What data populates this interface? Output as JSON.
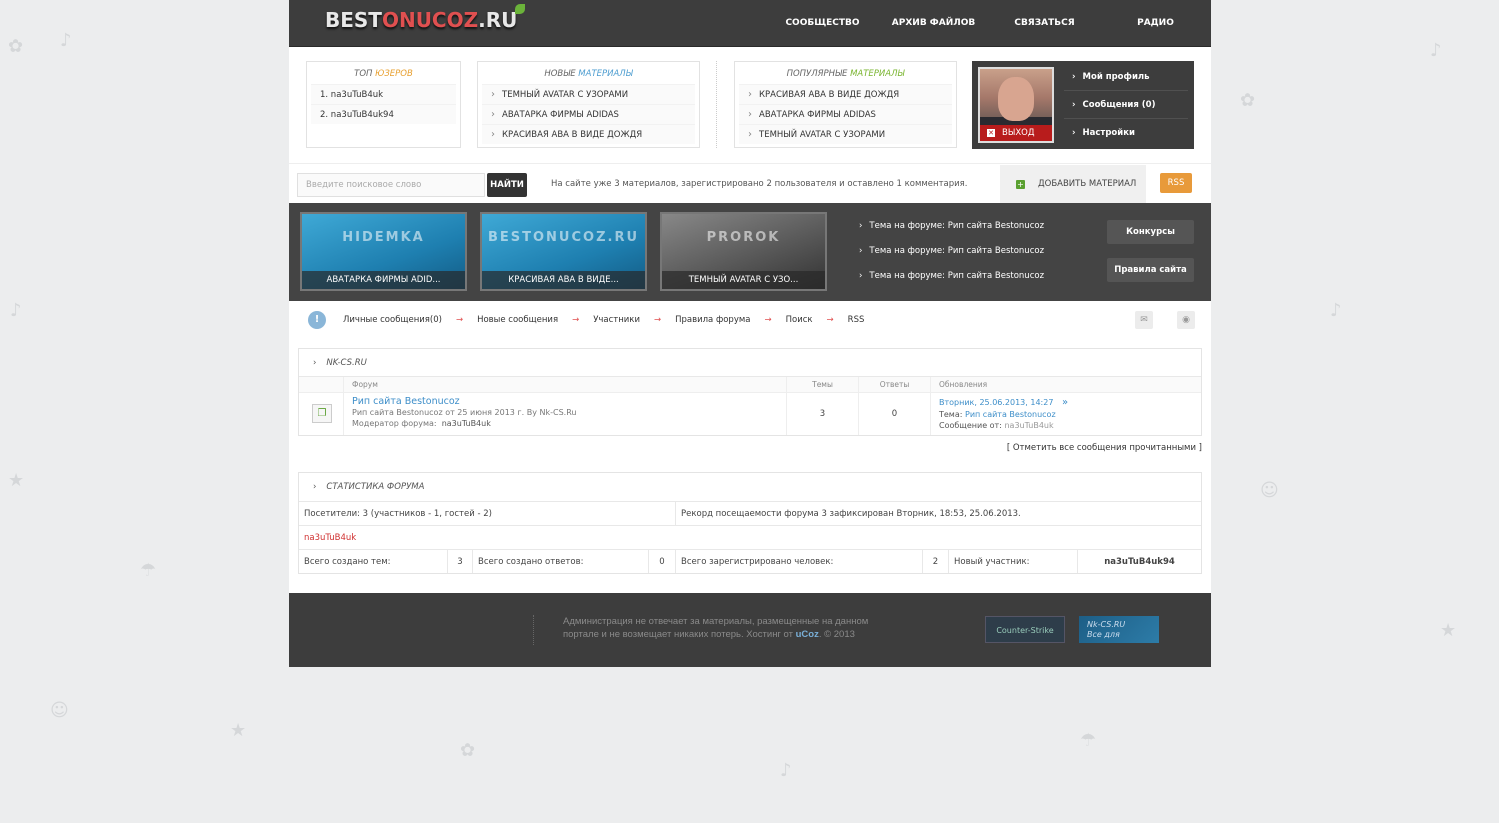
{
  "header": {
    "logo_pre": "BEST",
    "logo_red": "ONUCOZ",
    "logo_post": ".RU",
    "nav": [
      "СООБЩЕСТВО",
      "АРХИВ ФАЙЛОВ",
      "СВЯЗАТЬСЯ",
      "РАДИО"
    ]
  },
  "top_users": {
    "title_pre": "ТОП",
    "title_hl": "ЮЗЕРОВ",
    "items": [
      "1. na3uTuB4uk",
      "2. na3uTuB4uk94"
    ]
  },
  "new_materials": {
    "title_pre": "НОВЫЕ",
    "title_hl": "МАТЕРИАЛЫ",
    "items": [
      "ТЕМНЫЙ AVATAR С УЗОРАМИ",
      "АВАТАРКА ФИРМЫ ADIDAS",
      "КРАСИВАЯ АВА В ВИДЕ ДОЖДЯ"
    ]
  },
  "popular_materials": {
    "title_pre": "ПОПУЛЯРНЫЕ",
    "title_hl": "МАТЕРИАЛЫ",
    "items": [
      "КРАСИВАЯ АВА В ВИДЕ ДОЖДЯ",
      "АВАТАРКА ФИРМЫ ADIDAS",
      "ТЕМНЫЙ AVATAR С УЗОРАМИ"
    ]
  },
  "user_panel": {
    "logout": "ВЫХОД",
    "menu": [
      "Мой профиль",
      "Сообщения (0)",
      "Настройки"
    ]
  },
  "search": {
    "placeholder": "Введите поисковое слово",
    "button": "НАЙТИ",
    "stat_text": "На сайте уже 3 материалов, зарегистрировано 2 пользователя и оставлено 1 комментария.",
    "add_material": "ДОБАВИТЬ МАТЕРИАЛ",
    "rss": "RSS"
  },
  "slider": {
    "thumbs": [
      {
        "big": "HIDEMKA",
        "caption": "АВАТАРКА ФИРМЫ ADID..."
      },
      {
        "big": "BESTONUCOZ.RU",
        "caption": "КРАСИВАЯ АВА В ВИДЕ..."
      },
      {
        "big": "PROROK",
        "caption": "ТЕМНЫЙ AVATAR С УЗО..."
      }
    ],
    "forum_links": [
      "Тема на форуме: Рип сайта Bestonucoz",
      "Тема на форуме: Рип сайта Bestonucoz",
      "Тема на форуме: Рип сайта Bestonucoz"
    ],
    "buttons": [
      "Конкурсы",
      "Правила сайта"
    ]
  },
  "forum_nav": {
    "info_icon": "!",
    "links": [
      "Личные сообщения(0)",
      "Новые сообщения",
      "Участники",
      "Правила форума",
      "Поиск",
      "RSS"
    ]
  },
  "forum": {
    "category": "NK-CS.RU",
    "headers": {
      "forum": "Форум",
      "topics": "Темы",
      "replies": "Ответы",
      "updates": "Обновления"
    },
    "rows": [
      {
        "name": "Рип сайта Bestonucoz",
        "desc": "Рип сайта Bestonucoz от 25 июня 2013 г. By Nk-CS.Ru",
        "mod_label": "Модератор форума:",
        "mod_name": "na3uTuB4uk",
        "topics": "3",
        "replies": "0",
        "upd_date": "Вторник, 25.06.2013, 14:27",
        "upd_topic_label": "Тема:",
        "upd_topic": "Рип сайта Bestonucoz",
        "upd_msg_label": "Сообщение от:",
        "upd_msg_user": "na3uTuB4uk"
      }
    ],
    "mark_read": "[ Отметить все сообщения прочитанными ]"
  },
  "stats": {
    "title": "СТАТИСТИКА ФОРУМА",
    "visitors": "Посетители: 3  (участников - 1, гостей - 2)",
    "record": "Рекорд посещаемости форума 3 зафиксирован Вторник, 18:53, 25.06.2013.",
    "online_user": "na3uTuB4uk",
    "topics_label": "Всего создано тем:",
    "topics_val": "3",
    "replies_label": "Всего создано ответов:",
    "replies_val": "0",
    "users_label": "Всего зарегистрировано человек:",
    "users_val": "2",
    "newest_label": "Новый участник:",
    "newest_val": "na3uTuB4uk94"
  },
  "footer": {
    "text_pre": "Администрация не отвечает за материалы, размещенные на данном портале и не возмещает никаких потерь. Хостинг от ",
    "text_brand": "uCoz",
    "text_post": ". © 2013",
    "badge1": "Counter-Strike",
    "badge2_line1": "Nk-CS.RU",
    "badge2_line2": "Все для"
  }
}
